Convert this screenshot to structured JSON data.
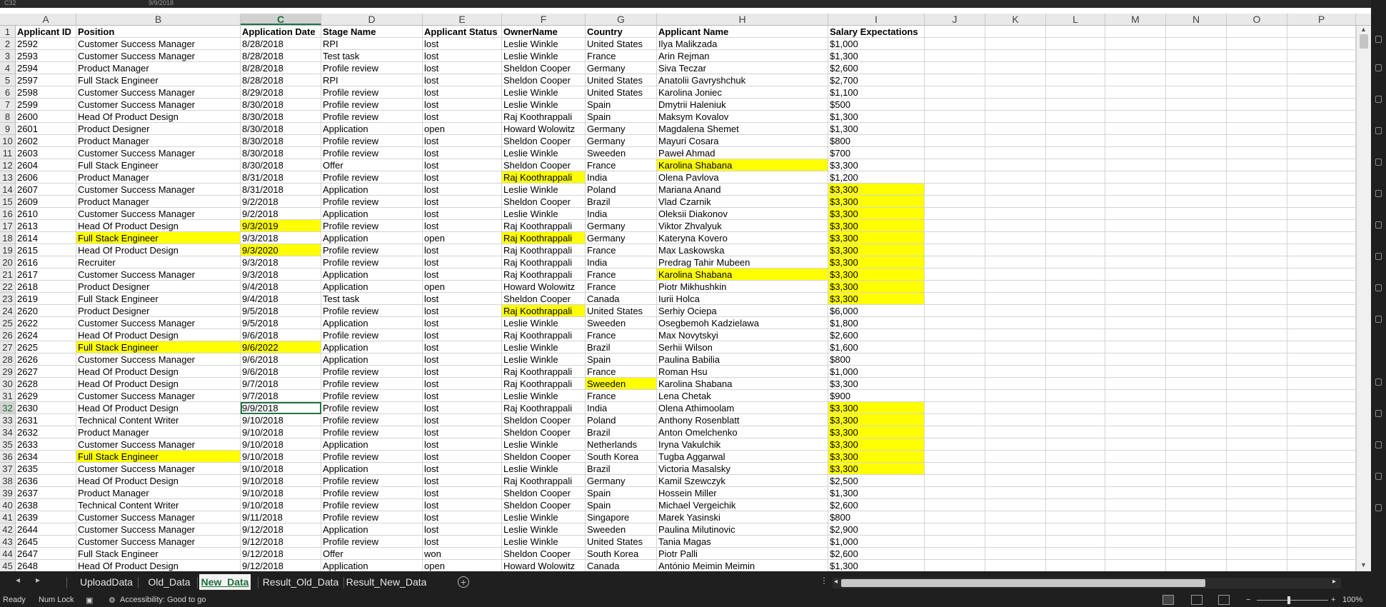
{
  "window": {
    "name_box": "C32",
    "formula_value": "9/9/2018"
  },
  "columns": [
    "A",
    "B",
    "C",
    "D",
    "E",
    "F",
    "G",
    "H",
    "I",
    "J",
    "K",
    "L",
    "M",
    "N",
    "O",
    "P"
  ],
  "selected_column": "C",
  "selected_row": "32",
  "header_row": {
    "num": "1",
    "cells": [
      "Applicant ID",
      "Position",
      "Application Date",
      "Stage Name",
      "Applicant Status",
      "OwnerName",
      "Country",
      "Applicant Name",
      "Salary Expectations"
    ]
  },
  "rows": [
    {
      "num": "2",
      "cells": [
        "2592",
        "Customer Success Manager",
        "8/28/2018",
        "RPI",
        "lost",
        "Leslie Winkle",
        "United States",
        "Ilya  Malikzada",
        "$1,000"
      ],
      "hl": []
    },
    {
      "num": "3",
      "cells": [
        "2593",
        "Customer Success Manager",
        "8/28/2018",
        "Test task",
        "lost",
        "Leslie Winkle",
        "France",
        "Arin  Rejman",
        "$1,300"
      ],
      "hl": []
    },
    {
      "num": "4",
      "cells": [
        "2594",
        "Product Manager",
        "8/28/2018",
        "Profile review",
        "lost",
        "Sheldon Cooper",
        "Germany",
        "Siva  Teczar",
        "$2,600"
      ],
      "hl": []
    },
    {
      "num": "5",
      "cells": [
        "2597",
        "Full Stack Engineer",
        "8/28/2018",
        "RPI",
        "lost",
        "Sheldon Cooper",
        "United States",
        "Anatolii  Gavryshchuk",
        "$2,700"
      ],
      "hl": []
    },
    {
      "num": "6",
      "cells": [
        "2598",
        "Customer Success Manager",
        "8/29/2018",
        "Profile review",
        "lost",
        "Leslie Winkle",
        "United States",
        "Karolina  Joniec",
        "$1,100"
      ],
      "hl": []
    },
    {
      "num": "7",
      "cells": [
        "2599",
        "Customer Success Manager",
        "8/30/2018",
        "Profile review",
        "lost",
        "Leslie Winkle",
        "Spain",
        "Dmytrii  Haleniuk",
        "$500"
      ],
      "hl": []
    },
    {
      "num": "8",
      "cells": [
        "2600",
        "Head Of Product Design",
        "8/30/2018",
        "Profile review",
        "lost",
        "Raj Koothrappali",
        "Spain",
        "Maksym  Kovalov",
        "$1,300"
      ],
      "hl": []
    },
    {
      "num": "9",
      "cells": [
        "2601",
        "Product Designer",
        "8/30/2018",
        "Application",
        "open",
        "Howard Wolowitz",
        "Germany",
        "Magdalena  Shemet",
        "$1,300"
      ],
      "hl": []
    },
    {
      "num": "10",
      "cells": [
        "2602",
        "Product Manager",
        "8/30/2018",
        "Profile review",
        "lost",
        "Sheldon Cooper",
        "Germany",
        "Mayuri  Cosara",
        "$800"
      ],
      "hl": []
    },
    {
      "num": "11",
      "cells": [
        "2603",
        "Customer Success Manager",
        "8/30/2018",
        "Profile review",
        "lost",
        "Leslie Winkle",
        "Sweeden",
        "Paweł  Ahmad",
        "$700"
      ],
      "hl": []
    },
    {
      "num": "12",
      "cells": [
        "2604",
        "Full Stack Engineer",
        "8/30/2018",
        "Offer",
        "lost",
        "Sheldon Cooper",
        "France",
        "Karolina   Shabana",
        "$3,300"
      ],
      "hl": [
        7
      ]
    },
    {
      "num": "13",
      "cells": [
        "2606",
        "Product Manager",
        "8/31/2018",
        "Profile review",
        "lost",
        "Raj Koothrappali",
        "India",
        "Olena  Pavlova",
        "$1,200"
      ],
      "hl": [
        5
      ]
    },
    {
      "num": "14",
      "cells": [
        "2607",
        "Customer Success Manager",
        "8/31/2018",
        "Application",
        "lost",
        "Leslie Winkle",
        "Poland",
        "Mariana  Anand",
        "$3,300"
      ],
      "hl": [
        8
      ]
    },
    {
      "num": "15",
      "cells": [
        "2609",
        "Product Manager",
        "9/2/2018",
        "Profile review",
        "lost",
        "Sheldon Cooper",
        "Brazil",
        "Vlad  Czarnik",
        "$3,300"
      ],
      "hl": [
        8
      ]
    },
    {
      "num": "16",
      "cells": [
        "2610",
        "Customer Success Manager",
        "9/2/2018",
        "Application",
        "lost",
        "Leslie Winkle",
        "India",
        "Oleksii  Diakonov",
        "$3,300"
      ],
      "hl": [
        8
      ]
    },
    {
      "num": "17",
      "cells": [
        "2613",
        "Head Of Product Design",
        "9/3/2019",
        "Profile review",
        "lost",
        "Raj Koothrappali",
        "Germany",
        "Viktor  Zhvalyuk",
        "$3,300"
      ],
      "hl": [
        2,
        8
      ]
    },
    {
      "num": "18",
      "cells": [
        "2614",
        "Full Stack Engineer",
        "9/3/2018",
        "Application",
        "open",
        "Raj Koothrappali",
        "Germany",
        "Kateryna  Kovero",
        "$3,300"
      ],
      "hl": [
        1,
        5,
        8
      ]
    },
    {
      "num": "19",
      "cells": [
        "2615",
        "Head Of Product Design",
        "9/3/2020",
        "Profile review",
        "lost",
        "Raj Koothrappali",
        "France",
        "Max  Laskowska",
        "$3,300"
      ],
      "hl": [
        2,
        8
      ]
    },
    {
      "num": "20",
      "cells": [
        "2616",
        "Recruiter",
        "9/3/2018",
        "Profile review",
        "lost",
        "Raj Koothrappali",
        "India",
        "Predrag  Tahir Mubeen",
        "$3,300"
      ],
      "hl": [
        8
      ]
    },
    {
      "num": "21",
      "cells": [
        "2617",
        "Customer Success Manager",
        "9/3/2018",
        "Application",
        "lost",
        "Raj Koothrappali",
        "France",
        "Karolina   Shabana",
        "$3,300"
      ],
      "hl": [
        7,
        8
      ]
    },
    {
      "num": "22",
      "cells": [
        "2618",
        "Product Designer",
        "9/4/2018",
        "Application",
        "open",
        "Howard Wolowitz",
        "France",
        "Piotr  Mikhushkin",
        "$3,300"
      ],
      "hl": [
        8
      ]
    },
    {
      "num": "23",
      "cells": [
        "2619",
        "Full Stack Engineer",
        "9/4/2018",
        "Test task",
        "lost",
        "Sheldon Cooper",
        "Canada",
        "Iurii  Holca",
        "$3,300"
      ],
      "hl": [
        8
      ]
    },
    {
      "num": "24",
      "cells": [
        "2620",
        "Product Designer",
        "9/5/2018",
        "Profile review",
        "lost",
        "Raj Koothrappali",
        "United States",
        "Serhiy  Ociepa",
        "$6,000"
      ],
      "hl": [
        5
      ]
    },
    {
      "num": "25",
      "cells": [
        "2622",
        "Customer Success Manager",
        "9/5/2018",
        "Application",
        "lost",
        "Leslie Winkle",
        "Sweeden",
        "Osegbemoh  Kadzielawa",
        "$1,800"
      ],
      "hl": []
    },
    {
      "num": "26",
      "cells": [
        "2624",
        "Head Of Product Design",
        "9/6/2018",
        "Profile review",
        "lost",
        "Raj Koothrappali",
        "France",
        "Max  Novytskyi",
        "$2,600"
      ],
      "hl": []
    },
    {
      "num": "27",
      "cells": [
        "2625",
        "Full Stack Engineer",
        "9/6/2022",
        "Application",
        "lost",
        "Leslie Winkle",
        "Brazil",
        "Serhii  Wilson",
        "$1,600"
      ],
      "hl": [
        1,
        2
      ]
    },
    {
      "num": "28",
      "cells": [
        "2626",
        "Customer Success Manager",
        "9/6/2018",
        "Application",
        "lost",
        "Leslie Winkle",
        "Spain",
        "Paulina  Babilia",
        "$800"
      ],
      "hl": []
    },
    {
      "num": "29",
      "cells": [
        "2627",
        "Head Of Product Design",
        "9/6/2018",
        "Profile review",
        "lost",
        "Raj Koothrappali",
        "France",
        "Roman  Hsu",
        "$1,000"
      ],
      "hl": []
    },
    {
      "num": "30",
      "cells": [
        "2628",
        "Head Of Product Design",
        "9/7/2018",
        "Profile review",
        "lost",
        "Raj Koothrappali",
        "Sweeden",
        "Karolina   Shabana",
        "$3,300"
      ],
      "hl": [
        6
      ]
    },
    {
      "num": "31",
      "cells": [
        "2629",
        "Customer Success Manager",
        "9/7/2018",
        "Profile review",
        "lost",
        "Leslie Winkle",
        "France",
        "Lena  Chetak",
        "$900"
      ],
      "hl": []
    },
    {
      "num": "32",
      "cells": [
        "2630",
        "Head Of Product Design",
        "9/9/2018",
        "Profile review",
        "lost",
        "Raj Koothrappali",
        "India",
        "Olena  Athimoolam",
        "$3,300"
      ],
      "hl": [
        8
      ]
    },
    {
      "num": "33",
      "cells": [
        "2631",
        "Technical Content Writer",
        "9/10/2018",
        "Profile review",
        "lost",
        "Sheldon Cooper",
        "Poland",
        "Anthony   Rosenblatt",
        "$3,300"
      ],
      "hl": [
        8
      ]
    },
    {
      "num": "34",
      "cells": [
        "2632",
        "Product Manager",
        "9/10/2018",
        "Profile review",
        "lost",
        "Sheldon Cooper",
        "Brazil",
        "Anton  Omelchenko",
        "$3,300"
      ],
      "hl": [
        8
      ]
    },
    {
      "num": "35",
      "cells": [
        "2633",
        "Customer Success Manager",
        "9/10/2018",
        "Application",
        "lost",
        "Leslie Winkle",
        "Netherlands",
        "Iryna  Vakulchik",
        "$3,300"
      ],
      "hl": [
        8
      ]
    },
    {
      "num": "36",
      "cells": [
        "2634",
        "Full Stack Engineer",
        "9/10/2018",
        "Profile review",
        "lost",
        "Sheldon Cooper",
        "South Korea",
        "Tugba  Aggarwal",
        "$3,300"
      ],
      "hl": [
        1,
        8
      ]
    },
    {
      "num": "37",
      "cells": [
        "2635",
        "Customer Success Manager",
        "9/10/2018",
        "Application",
        "lost",
        "Leslie Winkle",
        "Brazil",
        "Victoria  Masalsky",
        "$3,300"
      ],
      "hl": [
        8
      ]
    },
    {
      "num": "38",
      "cells": [
        "2636",
        "Head Of Product Design",
        "9/10/2018",
        "Profile review",
        "lost",
        "Raj Koothrappali",
        "Germany",
        "Kamil  Szewczyk",
        "$2,500"
      ],
      "hl": []
    },
    {
      "num": "39",
      "cells": [
        "2637",
        "Product Manager",
        "9/10/2018",
        "Profile review",
        "lost",
        "Sheldon Cooper",
        "Spain",
        "Hossein  Miller",
        "$1,300"
      ],
      "hl": []
    },
    {
      "num": "40",
      "cells": [
        "2638",
        "Technical Content Writer",
        "9/10/2018",
        "Profile review",
        "lost",
        "Sheldon Cooper",
        "Spain",
        "Michael  Vergeichik",
        "$2,600"
      ],
      "hl": []
    },
    {
      "num": "41",
      "cells": [
        "2639",
        "Customer Success Manager",
        "9/11/2018",
        "Profile review",
        "lost",
        "Leslie Winkle",
        "Singapore",
        "Marek   Yasinski",
        "$800"
      ],
      "hl": []
    },
    {
      "num": "42",
      "cells": [
        "2644",
        "Customer Success Manager",
        "9/12/2018",
        "Application",
        "lost",
        "Leslie Winkle",
        "Sweeden",
        "Paulina  Milutinovic",
        "$2,900"
      ],
      "hl": []
    },
    {
      "num": "43",
      "cells": [
        "2645",
        "Customer Success Manager",
        "9/12/2018",
        "Profile review",
        "lost",
        "Leslie Winkle",
        "United States",
        "Tania  Magas",
        "$1,000"
      ],
      "hl": []
    },
    {
      "num": "44",
      "cells": [
        "2647",
        "Full Stack Engineer",
        "9/12/2018",
        "Offer",
        "won",
        "Sheldon Cooper",
        "South Korea",
        "Piotr  Palli",
        "$2,600"
      ],
      "hl": []
    },
    {
      "num": "45",
      "cells": [
        "2648",
        "Head Of Product Design",
        "9/12/2018",
        "Application",
        "open",
        "Howard Wolowitz",
        "Canada",
        "António  Meimin Meimin",
        "$1,300"
      ],
      "hl": []
    }
  ],
  "sheet_tabs": [
    {
      "label": "UploadData",
      "active": false
    },
    {
      "label": "Old_Data",
      "active": false
    },
    {
      "label": "New_Data",
      "active": true
    },
    {
      "label": "Result_Old_Data",
      "active": false
    },
    {
      "label": "Result_New_Data",
      "active": false
    }
  ],
  "status": {
    "ready": "Ready",
    "num_lock": "Num Lock",
    "accessibility": "Accessibility: Good to go",
    "zoom": "100%"
  },
  "colors": {
    "highlight": "#ffff00",
    "accent": "#217346",
    "chrome": "#1f1f1f"
  }
}
